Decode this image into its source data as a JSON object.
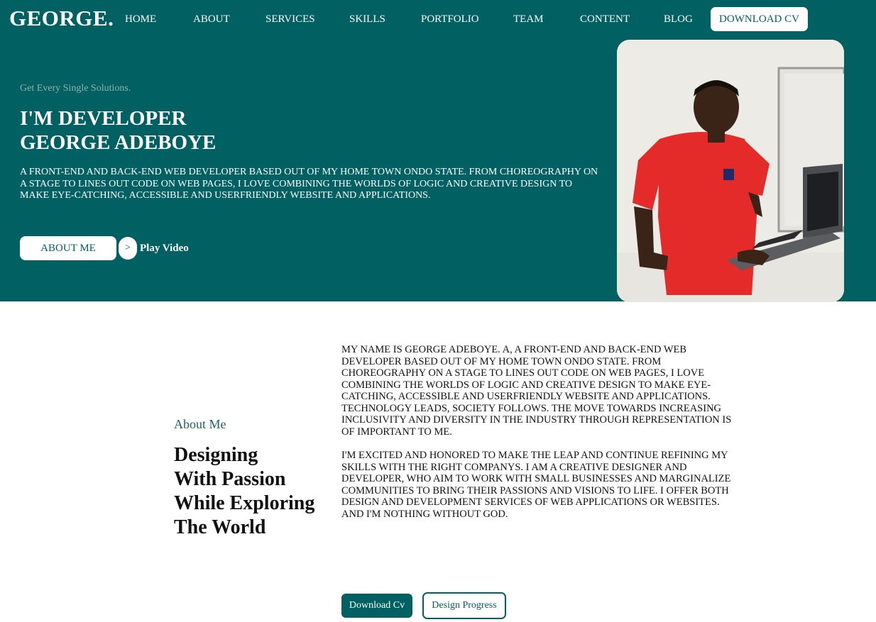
{
  "brand": {
    "logo": "GEORGE."
  },
  "nav": {
    "items": [
      "HOME",
      "ABOUT",
      "SERVICES",
      "SKILLS",
      "PORTFOLIO",
      "TEAM",
      "CONTENT",
      "BLOG"
    ],
    "cta": "DOWNLOAD CV"
  },
  "hero": {
    "tagline": "Get Every Single Solutions.",
    "title_line1": "I'M DEVELOPER",
    "title_line2": "GEORGE ADEBOYE",
    "description": "A FRONT-END AND BACK-END WEB DEVELOPER BASED OUT OF MY HOME TOWN ONDO STATE. FROM CHOREOGRAPHY ON A STAGE TO LINES OUT CODE ON WEB PAGES, I LOVE COMBINING THE WORLDS OF LOGIC AND CREATIVE DESIGN TO MAKE EYE-CATCHING, ACCESSIBLE AND USERFRIENDLY WEBSITE AND APPLICATIONS.",
    "about_button": "ABOUT ME",
    "play_icon": ">",
    "play_label": "Play Video"
  },
  "about": {
    "label": "About Me",
    "heading_lines": [
      "Designing",
      "With Passion",
      "While Exploring",
      "The World"
    ],
    "paragraph1": "MY NAME IS GEORGE ADEBOYE. A, A FRONT-END AND BACK-END WEB DEVELOPER BASED OUT OF MY HOME TOWN ONDO STATE. FROM CHOREOGRAPHY ON A STAGE TO LINES OUT CODE ON WEB PAGES, I LOVE COMBINING THE WORLDS OF LOGIC AND CREATIVE DESIGN TO MAKE EYE-CATCHING, ACCESSIBLE AND USERFRIENDLY WEBSITE AND APPLICATIONS. TECHNOLOGY LEADS, SOCIETY FOLLOWS. THE MOVE TOWARDS INCREASING INCLUSIVITY AND DIVERSITY IN THE INDUSTRY THROUGH REPRESENTATION IS OF IMPORTANT TO ME.",
    "paragraph2": "I'M EXCITED AND HONORED TO MAKE THE LEAP AND CONTINUE REFINING MY SKILLS WITH THE RIGHT COMPANYS. I AM A CREATIVE DESIGNER AND DEVELOPER, WHO AIM TO WORK WITH SMALL BUSINESSES AND MARGINALIZE COMMUNITIES TO BRING THEIR PASSIONS AND VISIONS TO LIFE. I OFFER BOTH DESIGN AND DEVELOPMENT SERVICES OF WEB APPLICATIONS OR WEBSITES.",
    "paragraph3": "AND I'M NOTHING WITHOUT GOD.",
    "download_button": "Download Cv",
    "progress_button": "Design Progress"
  },
  "colors": {
    "primary": "#006062",
    "accent_text": "#1e5f60",
    "tagline": "#8fb2b0"
  }
}
